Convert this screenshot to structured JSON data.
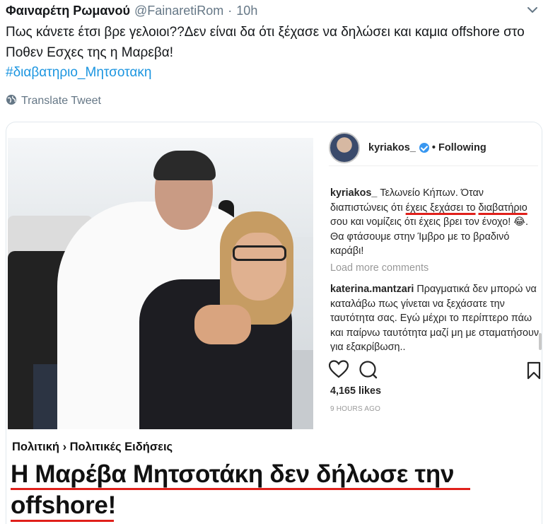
{
  "tweet": {
    "author_name": "Φαιναρέτη Ρωμανού",
    "author_handle": "@FainaretiRom",
    "separator": "·",
    "time": "10h",
    "text": "Πως κάνετε έτσι βρε γελοιοι??Δεν είναι δα ότι ξέχασε να δηλώσει και καμια offshore στο Ποθεν Εσχες της η Μαρεβα!",
    "hashtag": "#διαβατηριο_Μητσοτακη",
    "translate_label": "Translate Tweet"
  },
  "instagram": {
    "username": "kyriakos_",
    "follow_status": "• Following",
    "caption_user": "kyriakos_",
    "caption_part1": "Τελωνείο Κήπων. Όταν διαπιστώνεις ότι ",
    "caption_underlined1": "έχεις ξεχάσει το",
    "caption_underlined2": "διαβατήριο",
    "caption_part2": " σου και νομίζεις ότι έχεις βρει τον ένοχο! 😂. Θα φτάσουμε στην Ίμβρο με το βραδινό καράβι!",
    "load_more": "Load more comments",
    "comment_user": "katerina.mantzari",
    "comment_text": "Πραγματικά δεν μπορώ να καταλάβω πως γίνεται να ξεχάσατε την ταυτότητα σας. Εγώ μέχρι το περίπτερο πάω και παίρνω ταυτότητα μαζί μη με σταματήσουν για εξακρίβωση..",
    "likes": "4,165 likes",
    "time_ago": "9 HOURS AGO"
  },
  "article": {
    "breadcrumb": "Πολιτική › Πολιτικές Ειδήσεις",
    "headline_line1": "Η Μαρέβα Μητσοτάκη δεν δήλωσε την",
    "headline_line2": "offshore!"
  },
  "colors": {
    "link_blue": "#1b95e0",
    "handle_gray": "#657786",
    "underline_red": "#e0201b",
    "ig_verified_blue": "#3897f0"
  },
  "icons": [
    "chevron-down-icon",
    "globe-icon",
    "verified-badge-icon",
    "heart-icon",
    "comment-icon",
    "bookmark-icon"
  ]
}
